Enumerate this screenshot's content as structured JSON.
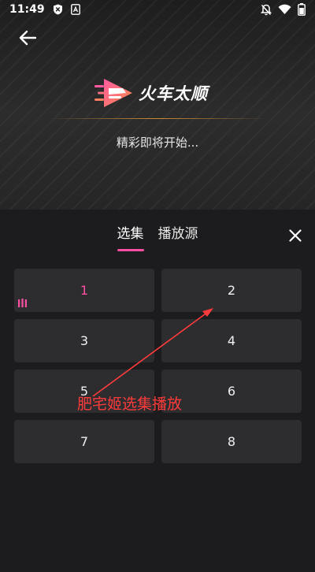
{
  "status_bar": {
    "time": "11:49",
    "left_icons": [
      "shield-icon",
      "sim-icon"
    ],
    "right_icons": [
      "notifications-off-icon",
      "wifi-icon",
      "battery-icon"
    ]
  },
  "player": {
    "brand_name": "火车太顺",
    "loading_text": "精彩即将开始..."
  },
  "sheet": {
    "tabs": [
      {
        "label": "选集",
        "active": true
      },
      {
        "label": "播放源",
        "active": false
      }
    ],
    "episodes": [
      {
        "label": "1",
        "playing": true
      },
      {
        "label": "2",
        "playing": false
      },
      {
        "label": "3",
        "playing": false
      },
      {
        "label": "4",
        "playing": false
      },
      {
        "label": "5",
        "playing": false
      },
      {
        "label": "6",
        "playing": false
      },
      {
        "label": "7",
        "playing": false
      },
      {
        "label": "8",
        "playing": false
      }
    ]
  },
  "annotation": {
    "text": "肥宅姬选集播放",
    "color": "#ff3b3b"
  },
  "colors": {
    "accent": "#ff4fa3",
    "background": "#1c1c1e",
    "card": "#2d2d30"
  }
}
